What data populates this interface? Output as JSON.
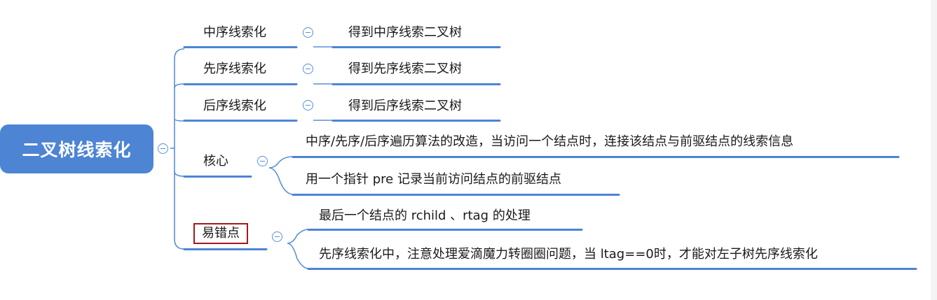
{
  "root": {
    "label": "二叉树线索化"
  },
  "branches": [
    {
      "label": "中序线索化",
      "children": [
        "得到中序线索二叉树"
      ]
    },
    {
      "label": "先序线索化",
      "children": [
        "得到先序线索二叉树"
      ]
    },
    {
      "label": "后序线索化",
      "children": [
        "得到后序线索二叉树"
      ]
    },
    {
      "label": "核心",
      "children": [
        "中序/先序/后序遍历算法的改造，当访问一个结点时，连接该结点与前驱结点的线索信息",
        "用一个指针 pre 记录当前访问结点的前驱结点"
      ]
    },
    {
      "label": "易错点",
      "highlighted": true,
      "children": [
        "最后一个结点的 rchild 、rtag 的处理",
        "先序线索化中，注意处理爱滴魔力转圈圈问题，当 ltag==0时，才能对左子树先序线索化"
      ]
    }
  ],
  "colors": {
    "root": "#4d84d4",
    "line": "#5a8fd8",
    "highlight": "#a3191c"
  },
  "icons": {
    "collapse": "minus-circle-icon"
  }
}
